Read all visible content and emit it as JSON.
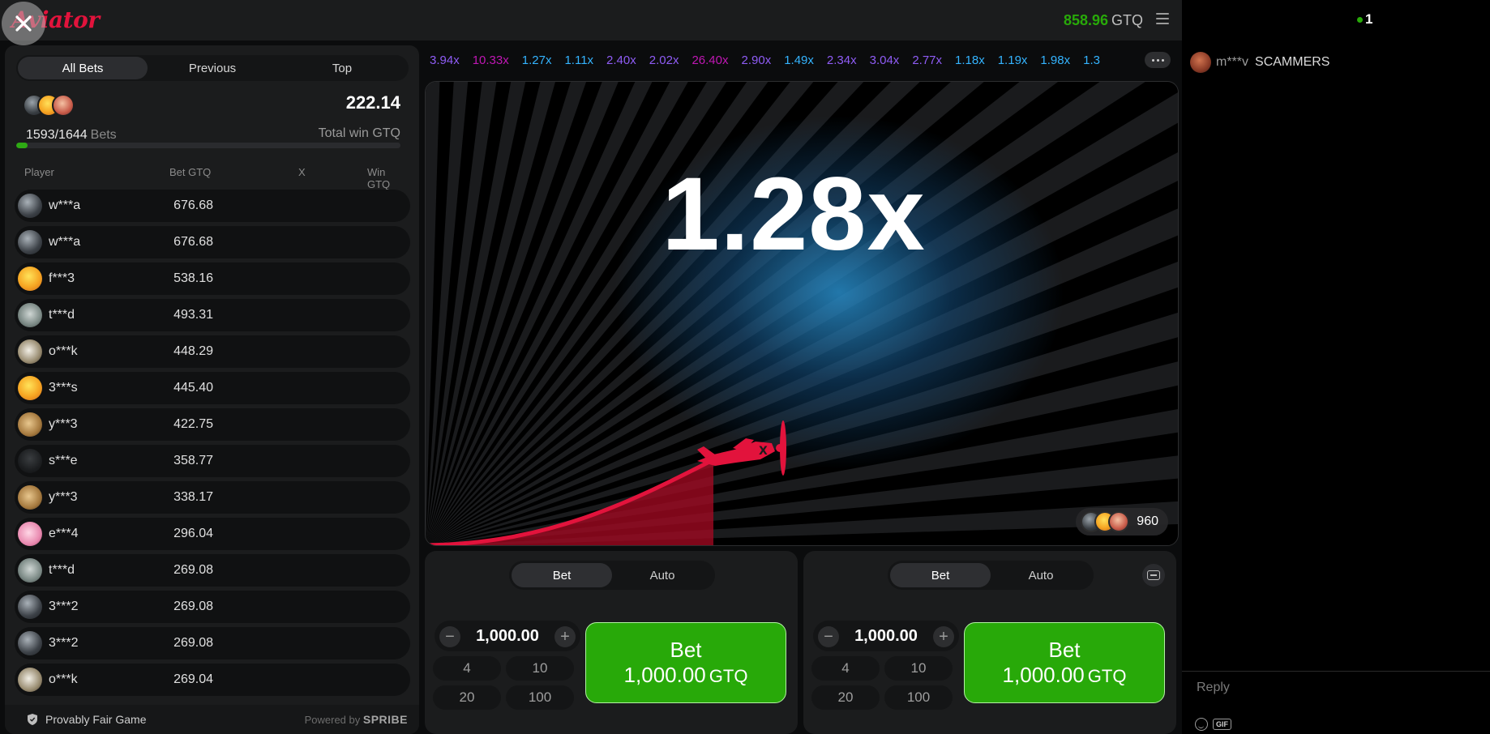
{
  "header": {
    "logo_text": "Aviator",
    "balance": "858.96",
    "currency": "GTQ"
  },
  "bets_panel": {
    "tabs": [
      "All Bets",
      "Previous",
      "Top"
    ],
    "active_tab": "All Bets",
    "bets_count": "1593/1644",
    "bets_label": "Bets",
    "total_win": "222.14",
    "total_win_label": "Total win GTQ",
    "progress_fraction": 0.03,
    "columns": [
      "Player",
      "Bet GTQ",
      "X",
      "Win GTQ"
    ],
    "rows": [
      {
        "player": "w***a",
        "bet": "676.68",
        "avatar": "dark-spaceman"
      },
      {
        "player": "w***a",
        "bet": "676.68",
        "avatar": "dark-spaceman"
      },
      {
        "player": "f***3",
        "bet": "538.16",
        "avatar": "yellow-burst"
      },
      {
        "player": "t***d",
        "bet": "493.31",
        "avatar": "plane"
      },
      {
        "player": "o***k",
        "bet": "448.29",
        "avatar": "eagle"
      },
      {
        "player": "3***s",
        "bet": "445.40",
        "avatar": "yellow-burst"
      },
      {
        "player": "y***3",
        "bet": "422.75",
        "avatar": "lion"
      },
      {
        "player": "s***e",
        "bet": "358.77",
        "avatar": "silhouette"
      },
      {
        "player": "y***3",
        "bet": "338.17",
        "avatar": "lion"
      },
      {
        "player": "e***4",
        "bet": "296.04",
        "avatar": "pink-face"
      },
      {
        "player": "t***d",
        "bet": "269.08",
        "avatar": "plane"
      },
      {
        "player": "3***2",
        "bet": "269.08",
        "avatar": "dark-spaceman"
      },
      {
        "player": "3***2",
        "bet": "269.08",
        "avatar": "dark-spaceman"
      },
      {
        "player": "o***k",
        "bet": "269.04",
        "avatar": "eagle"
      }
    ],
    "footer": {
      "provably_fair": "Provably Fair Game",
      "powered_by": "Powered by",
      "brand": "SPRIBE"
    }
  },
  "history": [
    {
      "value": "3.94x",
      "color": "#8f5cf5"
    },
    {
      "value": "10.33x",
      "color": "#c017b4"
    },
    {
      "value": "1.27x",
      "color": "#34b4ff"
    },
    {
      "value": "1.11x",
      "color": "#34b4ff"
    },
    {
      "value": "2.40x",
      "color": "#8f5cf5"
    },
    {
      "value": "2.02x",
      "color": "#8f5cf5"
    },
    {
      "value": "26.40x",
      "color": "#c017b4"
    },
    {
      "value": "2.90x",
      "color": "#8f5cf5"
    },
    {
      "value": "1.49x",
      "color": "#34b4ff"
    },
    {
      "value": "2.34x",
      "color": "#8f5cf5"
    },
    {
      "value": "3.04x",
      "color": "#8f5cf5"
    },
    {
      "value": "2.77x",
      "color": "#8f5cf5"
    },
    {
      "value": "1.18x",
      "color": "#34b4ff"
    },
    {
      "value": "1.19x",
      "color": "#34b4ff"
    },
    {
      "value": "1.98x",
      "color": "#34b4ff"
    },
    {
      "value": "1.3",
      "color": "#34b4ff"
    }
  ],
  "stage": {
    "multiplier": "1.28x",
    "players_count": "960"
  },
  "bet_panels": [
    {
      "tabs": [
        "Bet",
        "Auto"
      ],
      "active_tab": "Bet",
      "amount": "1,000.00",
      "quick": [
        "4",
        "10",
        "20",
        "100"
      ],
      "button_label": "Bet",
      "button_amount": "1,000.00",
      "button_currency": "GTQ"
    },
    {
      "tabs": [
        "Bet",
        "Auto"
      ],
      "active_tab": "Bet",
      "amount": "1,000.00",
      "quick": [
        "4",
        "10",
        "20",
        "100"
      ],
      "button_label": "Bet",
      "button_amount": "1,000.00",
      "button_currency": "GTQ"
    }
  ],
  "chat": {
    "online_count": "1",
    "messages": [
      {
        "user": "m***v",
        "text": "SCAMMERS"
      }
    ],
    "reply_placeholder": "Reply",
    "gif_label": "GIF"
  },
  "colors": {
    "accent_red": "#e2133c",
    "bet_green": "#28a909",
    "panel_bg": "#1b1c1d"
  }
}
